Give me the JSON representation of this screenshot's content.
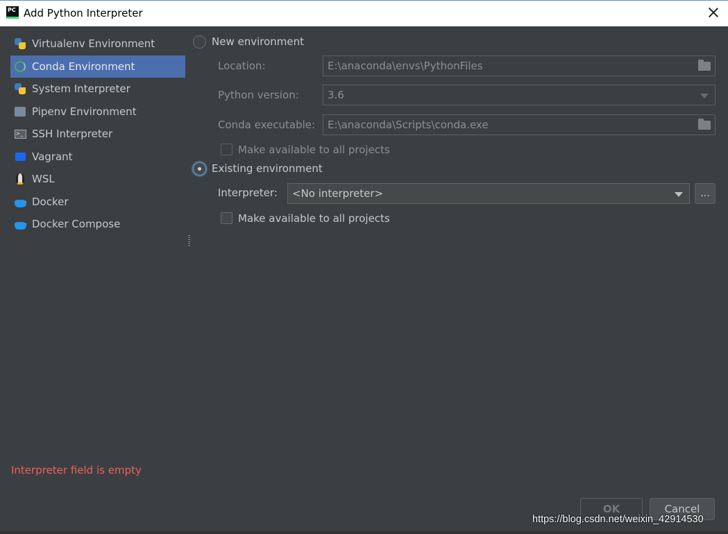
{
  "window": {
    "app_icon_text": "PC",
    "title": "Add Python Interpreter"
  },
  "sidebar": {
    "items": [
      {
        "label": "Virtualenv Environment",
        "icon": "python-icon"
      },
      {
        "label": "Conda Environment",
        "icon": "conda-icon",
        "selected": true
      },
      {
        "label": "System Interpreter",
        "icon": "python-icon"
      },
      {
        "label": "Pipenv Environment",
        "icon": "pipenv-icon"
      },
      {
        "label": "SSH Interpreter",
        "icon": "ssh-icon"
      },
      {
        "label": "Vagrant",
        "icon": "vagrant-icon"
      },
      {
        "label": "WSL",
        "icon": "linux-icon"
      },
      {
        "label": "Docker",
        "icon": "docker-icon"
      },
      {
        "label": "Docker Compose",
        "icon": "docker-icon"
      }
    ]
  },
  "new_env": {
    "radio_label": "New environment",
    "location_label": "Location:",
    "location_value": "E:\\anaconda\\envs\\PythonFiles",
    "python_version_label": "Python version:",
    "python_version_value": "3.6",
    "conda_exe_label": "Conda executable:",
    "conda_exe_value": "E:\\anaconda\\Scripts\\conda.exe",
    "make_available_label": "Make available to all projects"
  },
  "existing_env": {
    "radio_label": "Existing environment",
    "interpreter_label": "Interpreter:",
    "interpreter_value": "<No interpreter>",
    "browse_label": "...",
    "make_available_label": "Make available to all projects"
  },
  "error_message": "Interpreter field is empty",
  "buttons": {
    "ok": "OK",
    "cancel": "Cancel"
  },
  "watermark": "https://blog.csdn.net/weixin_42914530",
  "colors": {
    "background": "#3c3f41",
    "selection": "#4b6eaf",
    "error": "#ee5f5f"
  }
}
